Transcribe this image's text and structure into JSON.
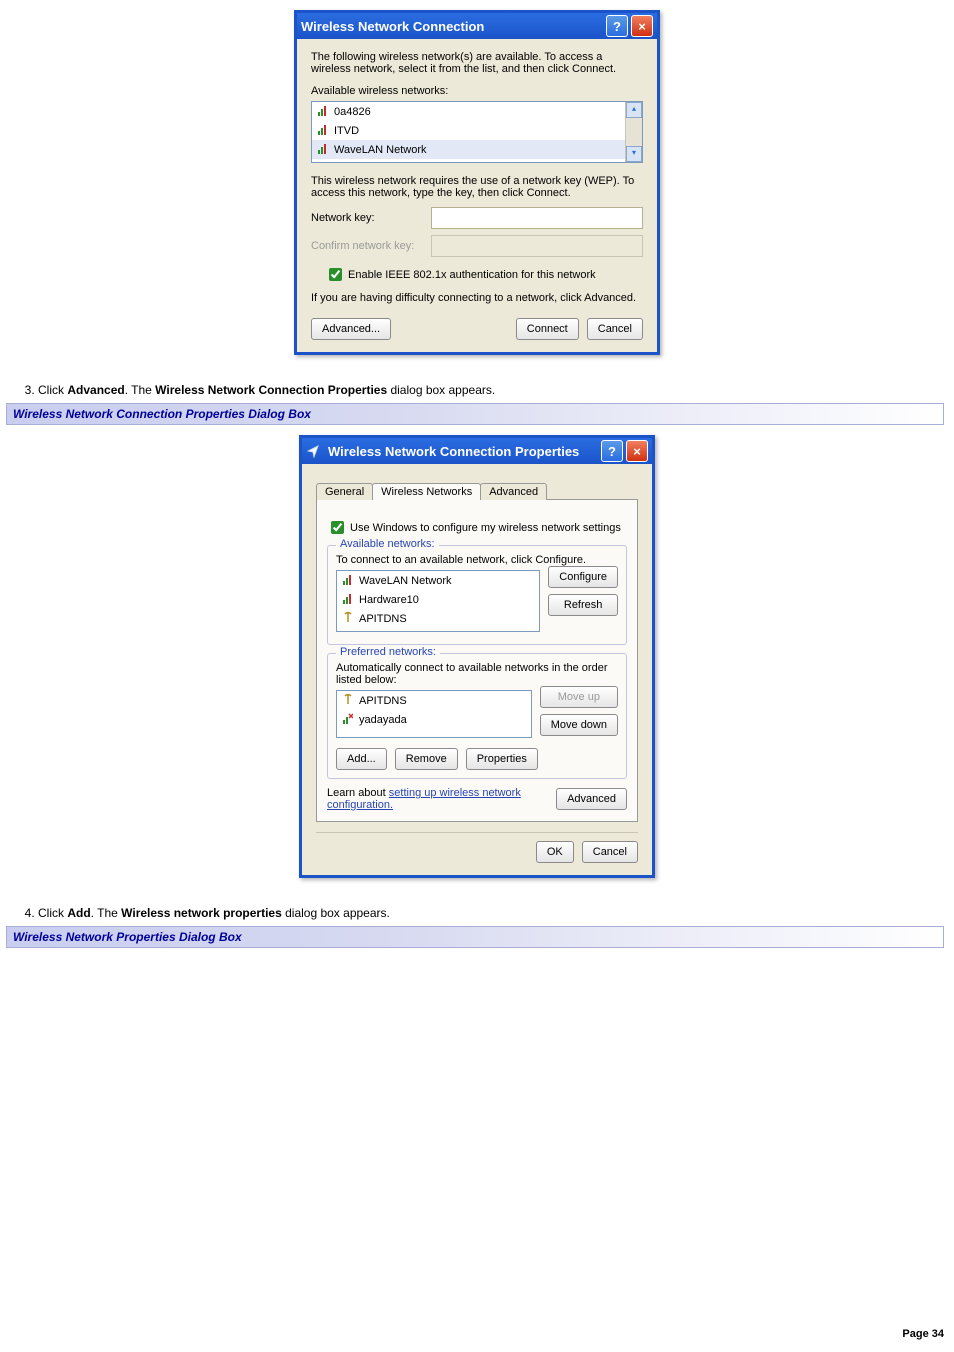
{
  "dialog1": {
    "title": "Wireless Network Connection",
    "intro": "The following wireless network(s) are available. To access a wireless network, select it from the list, and then click Connect.",
    "list_label": "Available wireless networks:",
    "networks": [
      "0a4826",
      "ITVD",
      "WaveLAN Network"
    ],
    "wep_text": "This wireless network requires the use of a network key (WEP). To access this network, type the key, then click Connect.",
    "key_label": "Network key:",
    "confirm_label": "Confirm network key:",
    "ieee_checkbox": "Enable IEEE 802.1x authentication for this network",
    "difficulty_text": "If you are having difficulty connecting to a network, click Advanced.",
    "advanced_btn": "Advanced...",
    "connect_btn": "Connect",
    "cancel_btn": "Cancel"
  },
  "step3": {
    "num": "3.",
    "pre": "Click ",
    "bold1": "Advanced",
    "mid": ". The ",
    "bold2": "Wireless Network Connection Properties",
    "post": " dialog box appears."
  },
  "heading1": "Wireless Network Connection Properties Dialog Box",
  "dialog2": {
    "title": "Wireless Network Connection Properties",
    "tabs": [
      "General",
      "Wireless Networks",
      "Advanced"
    ],
    "use_win_chk": "Use Windows to configure my wireless network settings",
    "avail_legend": "Available networks:",
    "avail_text": "To connect to an available network, click Configure.",
    "avail_items": [
      "WaveLAN Network",
      "Hardware10",
      "APITDNS"
    ],
    "configure_btn": "Configure",
    "refresh_btn": "Refresh",
    "pref_legend": "Preferred networks:",
    "pref_text": "Automatically connect to available networks in the order listed below:",
    "pref_items": [
      "APITDNS",
      "yadayada"
    ],
    "moveup_btn": "Move up",
    "movedown_btn": "Move down",
    "add_btn": "Add...",
    "remove_btn": "Remove",
    "properties_btn": "Properties",
    "learn_pre": "Learn about ",
    "learn_link": "setting up wireless network configuration.",
    "advanced_btn": "Advanced",
    "ok_btn": "OK",
    "cancel_btn": "Cancel"
  },
  "step4": {
    "num": "4.",
    "pre": "Click ",
    "bold1": "Add",
    "mid": ". The ",
    "bold2": "Wireless network properties",
    "post": " dialog box appears."
  },
  "heading2": "Wireless Network Properties Dialog Box",
  "page_number": "Page 34"
}
